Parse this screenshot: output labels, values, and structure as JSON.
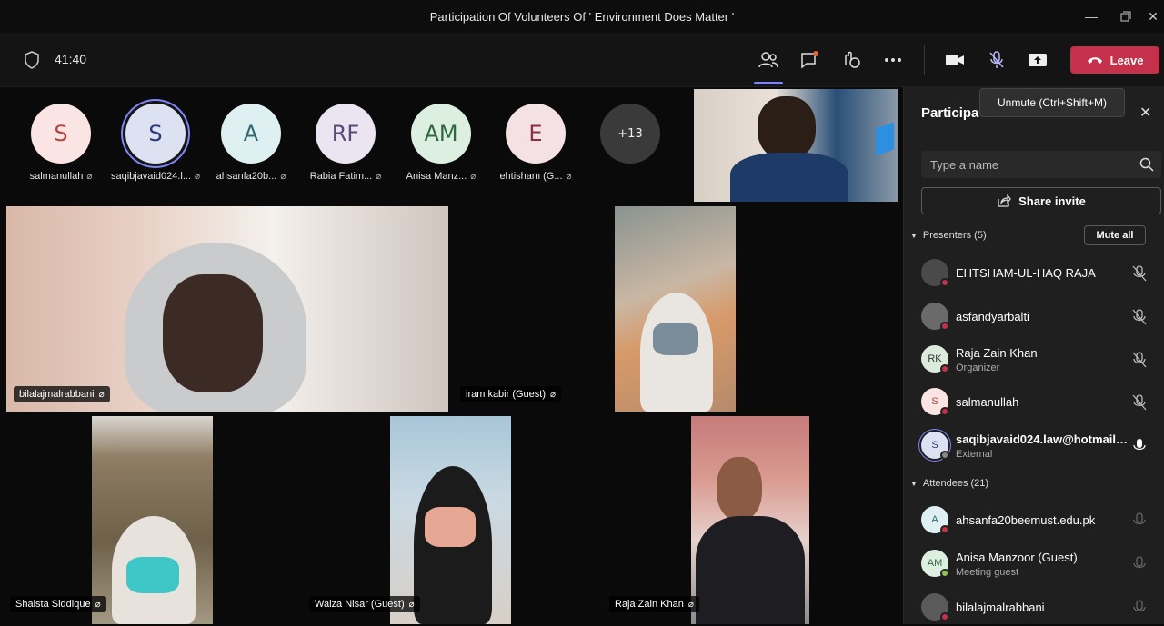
{
  "window": {
    "title": "Participation Of Volunteers Of ' Environment Does Matter '"
  },
  "toolbar": {
    "timer": "41:40",
    "leave_label": "Leave"
  },
  "tooltip": {
    "text": "Unmute (Ctrl+Shift+M)"
  },
  "avatars": [
    {
      "initials": "S",
      "name": "salmanullah",
      "bg": "#fbe4e4",
      "color": "#b0463f"
    },
    {
      "initials": "S",
      "name": "saqibjavaid024.l...",
      "bg": "#dce2f2",
      "color": "#2b3a78"
    },
    {
      "initials": "A",
      "name": "ahsanfa20b...",
      "bg": "#dff0f3",
      "color": "#2f6770"
    },
    {
      "initials": "RF",
      "name": "Rabia Fatim...",
      "bg": "#ebe5f2",
      "color": "#5a4b7a"
    },
    {
      "initials": "AM",
      "name": "Anisa Manz...",
      "bg": "#dcefe1",
      "color": "#2f6a3f"
    },
    {
      "initials": "E",
      "name": "ehtisham (G...",
      "bg": "#f3e1e4",
      "color": "#8b2f3e"
    }
  ],
  "overflow_count": "+13",
  "videos": [
    {
      "name": "bilalajmalrabbani"
    },
    {
      "name": "iram kabir (Guest)"
    },
    {
      "name": "Shaista Siddique"
    },
    {
      "name": "Waiza Nisar (Guest)"
    },
    {
      "name": "Raja Zain Khan"
    }
  ],
  "panel": {
    "title": "Participa",
    "search_placeholder": "Type a name",
    "share_label": "Share invite",
    "presenters_header": "Presenters (5)",
    "mute_all_label": "Mute all",
    "attendees_header": "Attendees (21)",
    "presenters": [
      {
        "initials": "",
        "name": "EHTSHAM-UL-HAQ RAJA",
        "role": "",
        "bg": "#4a4a4a"
      },
      {
        "initials": "",
        "name": "asfandyarbalti",
        "role": "",
        "bg": "#6a6a6a"
      },
      {
        "initials": "RK",
        "name": "Raja Zain Khan",
        "role": "Organizer",
        "bg": "#dcebdc"
      },
      {
        "initials": "S",
        "name": "salmanullah",
        "role": "",
        "bg": "#fbe4e4"
      },
      {
        "initials": "S",
        "name": "saqibjavaid024.law@hotmail....",
        "role": "External",
        "bg": "#dce2f2"
      }
    ],
    "attendees": [
      {
        "initials": "A",
        "name": "ahsanfa20beemust.edu.pk",
        "role": "",
        "bg": "#dff0f3"
      },
      {
        "initials": "AM",
        "name": "Anisa Manzoor (Guest)",
        "role": "Meeting guest",
        "bg": "#dcefe1"
      },
      {
        "initials": "",
        "name": "bilalajmalrabbani",
        "role": "",
        "bg": "#5a5a5a"
      }
    ]
  }
}
